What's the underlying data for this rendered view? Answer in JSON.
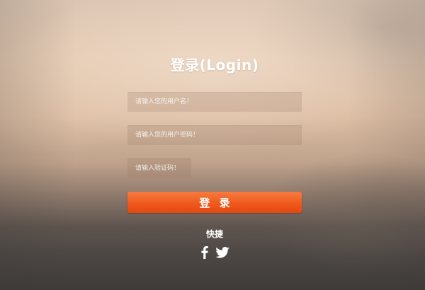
{
  "login": {
    "title": "登录(Login)",
    "username_placeholder": "请输入您的用户名！",
    "password_placeholder": "请输入您的用户密码！",
    "captcha_placeholder": "请输入验证码！",
    "submit_label": "登 录",
    "quick_label": "快捷",
    "social": [
      {
        "name": "facebook",
        "icon": "facebook-icon"
      },
      {
        "name": "twitter",
        "icon": "twitter-icon"
      }
    ]
  },
  "colors": {
    "accent": "#ef5a1d",
    "text": "#ffffff"
  }
}
